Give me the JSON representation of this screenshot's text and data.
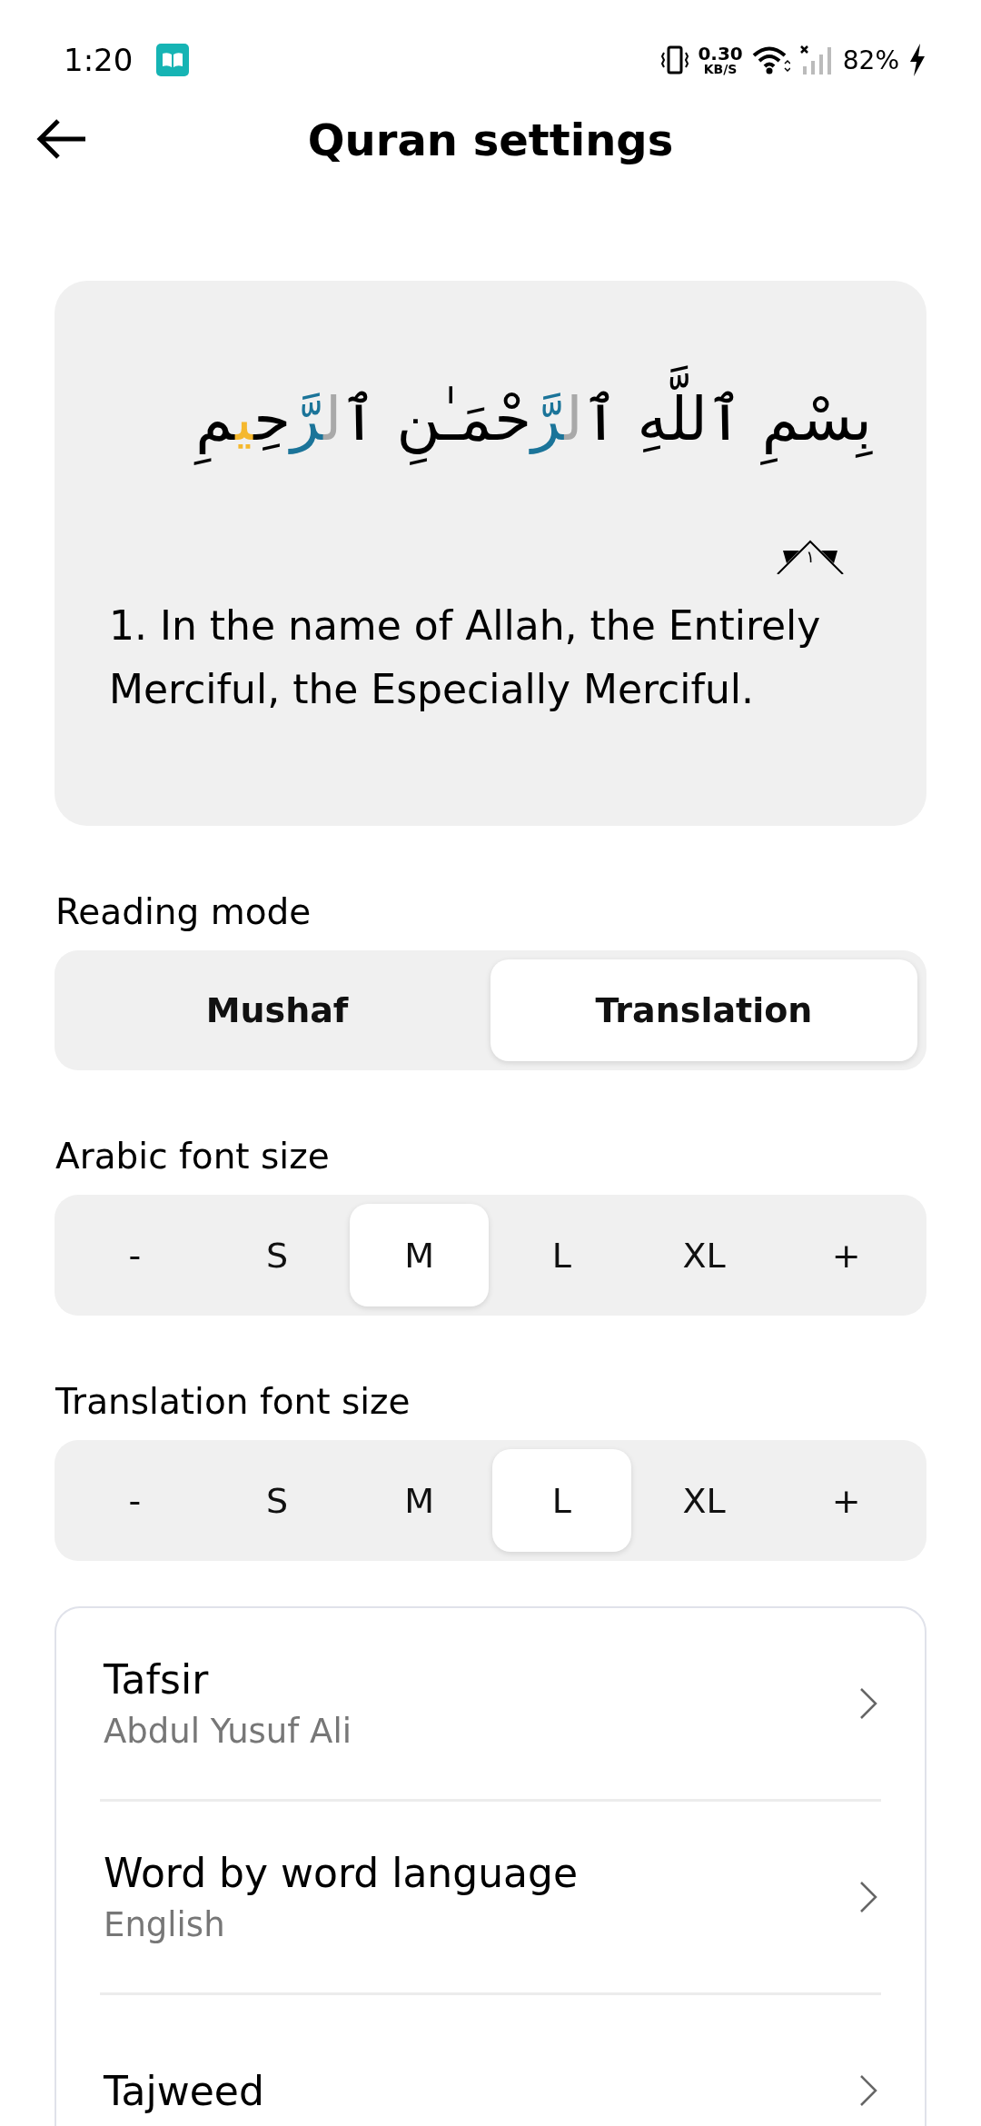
{
  "status_bar": {
    "time": "1:20",
    "speed": "0.30",
    "speed_unit": "KB/S",
    "battery": "82%"
  },
  "header": {
    "title": "Quran settings"
  },
  "preview": {
    "arabic": [
      {
        "text": "بِسْمِ ٱللَّهِ ٱ",
        "color": "#000000"
      },
      {
        "text": "ل",
        "color": "#a9a9a9"
      },
      {
        "text": "رَّ",
        "color": "#1b7499"
      },
      {
        "text": "حْمَـٰنِ ٱ",
        "color": "#000000"
      },
      {
        "text": "ل",
        "color": "#a9a9a9"
      },
      {
        "text": "رَّ",
        "color": "#1b7499"
      },
      {
        "text": "حِ",
        "color": "#000000"
      },
      {
        "text": "ي",
        "color": "#f5b82e"
      },
      {
        "text": "مِ",
        "color": "#000000"
      }
    ],
    "ayah_number": "١",
    "translation": "1. In the name of Allah, the Entirely Merciful, the Especially Merciful."
  },
  "sections": [
    {
      "label": "Reading mode",
      "kind": "mode",
      "options": [
        {
          "label": "Mushaf",
          "selected": false
        },
        {
          "label": "Translation",
          "selected": true
        }
      ]
    },
    {
      "label": "Arabic font size",
      "kind": "size",
      "options": [
        {
          "label": "-",
          "selected": false
        },
        {
          "label": "S",
          "selected": false
        },
        {
          "label": "M",
          "selected": true
        },
        {
          "label": "L",
          "selected": false
        },
        {
          "label": "XL",
          "selected": false
        },
        {
          "label": "+",
          "selected": false
        }
      ]
    },
    {
      "label": "Translation font size",
      "kind": "size",
      "options": [
        {
          "label": "-",
          "selected": false
        },
        {
          "label": "S",
          "selected": false
        },
        {
          "label": "M",
          "selected": false
        },
        {
          "label": "L",
          "selected": true
        },
        {
          "label": "XL",
          "selected": false
        },
        {
          "label": "+",
          "selected": false
        }
      ]
    }
  ],
  "menu": [
    {
      "title": "Tafsir",
      "subtitle": "Abdul Yusuf Ali"
    },
    {
      "title": "Word by word language",
      "subtitle": "English"
    },
    {
      "title": "Tajweed"
    }
  ]
}
